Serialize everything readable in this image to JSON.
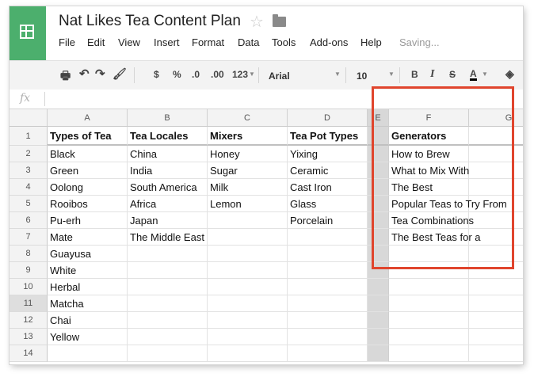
{
  "app": {
    "title": "Nat Likes Tea Content Plan",
    "save_status": "Saving..."
  },
  "menu": [
    "File",
    "Edit",
    "View",
    "Insert",
    "Format",
    "Data",
    "Tools",
    "Add-ons",
    "Help"
  ],
  "toolbar": {
    "currency": "$",
    "percent": "%",
    "decrease_decimal": ".0",
    "increase_decimal": ".00",
    "more_formats": "123",
    "font": "Arial",
    "font_size": "10",
    "bold": "B",
    "italic": "I",
    "strike": "S",
    "text_color": "A"
  },
  "formula_bar": {
    "label": "fx",
    "value": ""
  },
  "columns": [
    "A",
    "B",
    "C",
    "D",
    "E",
    "F",
    "G"
  ],
  "rows": [
    [
      "Types of Tea",
      "Tea Locales",
      "Mixers",
      "Tea Pot Types",
      "",
      "Generators",
      ""
    ],
    [
      "Black",
      "China",
      "Honey",
      "Yixing",
      "",
      "How to Brew",
      ""
    ],
    [
      "Green",
      "India",
      "Sugar",
      "Ceramic",
      "",
      "What to Mix With",
      ""
    ],
    [
      "Oolong",
      "South America",
      "Milk",
      "Cast Iron",
      "",
      "The Best",
      ""
    ],
    [
      "Rooibos",
      "Africa",
      "Lemon",
      "Glass",
      "",
      "Popular Teas to Try From",
      ""
    ],
    [
      "Pu-erh",
      "Japan",
      "",
      "Porcelain",
      "",
      "Tea Combinations",
      ""
    ],
    [
      "Mate",
      "The Middle East",
      "",
      "",
      "",
      "The Best Teas for a",
      ""
    ],
    [
      "Guayusa",
      "",
      "",
      "",
      "",
      "",
      ""
    ],
    [
      "White",
      "",
      "",
      "",
      "",
      "",
      ""
    ],
    [
      "Herbal",
      "",
      "",
      "",
      "",
      "",
      ""
    ],
    [
      "Matcha",
      "",
      "",
      "",
      "",
      "",
      ""
    ],
    [
      "Chai",
      "",
      "",
      "",
      "",
      "",
      ""
    ],
    [
      "Yellow",
      "",
      "",
      "",
      "",
      "",
      ""
    ],
    [
      "",
      "",
      "",
      "",
      "",
      "",
      ""
    ]
  ],
  "row_numbers": [
    "1",
    "2",
    "3",
    "4",
    "5",
    "6",
    "7",
    "8",
    "9",
    "10",
    "11",
    "12",
    "13",
    "14"
  ],
  "colors": {
    "logo": "#4caf6d",
    "annotation_box": "#e0452d",
    "selected_column": "#d8d8d8"
  }
}
